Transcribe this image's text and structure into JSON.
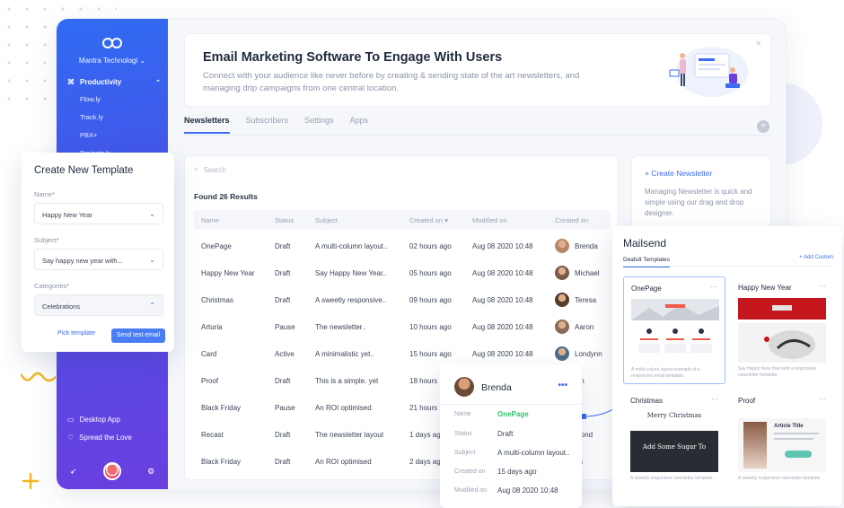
{
  "sidebar": {
    "org": "Mantra Technologi ⌄",
    "group": "Productivity",
    "items": [
      "Flow.ly",
      "Track.ly",
      "PBX+",
      "Projects.ly"
    ],
    "bottom": [
      "Desktop App",
      "Spread the Love"
    ]
  },
  "hero": {
    "title": "Email Marketing Software To Engage With Users",
    "subtitle": "Connect with your audience like never before by creating & sending state of the art newsletters, and managing drip campaigns from one central location."
  },
  "tabs": [
    "Newsletters",
    "Subscribers",
    "Settings",
    "Apps"
  ],
  "table": {
    "search_placeholder": "Search",
    "found": "Found 26 Results",
    "headers": [
      "Name",
      "Status",
      "Subject",
      "Created on",
      "Modified on",
      "Created on"
    ],
    "rows": [
      {
        "name": "OnePage",
        "status": "Draft",
        "subject": "A multi-column layout..",
        "created": "02 hours ago",
        "modified": "Aug 08 2020 10:48",
        "by": "Brenda"
      },
      {
        "name": "Happy New Year",
        "status": "Draft",
        "subject": "Say Happy New Year..",
        "created": "05 hours ago",
        "modified": "Aug 08 2020 10:48",
        "by": "Michael"
      },
      {
        "name": "Christmas",
        "status": "Draft",
        "subject": "A sweetly responsive..",
        "created": "09 hours ago",
        "modified": "Aug 08 2020 10:48",
        "by": "Teresa"
      },
      {
        "name": "Arturia",
        "status": "Pause",
        "subject": "The newsletter..",
        "created": "10 hours ago",
        "modified": "Aug 08 2020 10:48",
        "by": "Aaron"
      },
      {
        "name": "Card",
        "status": "Active",
        "subject": "A minimalistic yet..",
        "created": "15 hours ago",
        "modified": "Aug 08 2020 10:48",
        "by": "Londynn"
      },
      {
        "name": "Proof",
        "status": "Draft",
        "subject": "This is a simple. yet",
        "created": "18 hours",
        "modified": "",
        "by": "lan"
      },
      {
        "name": "Black Friday",
        "status": "Pause",
        "subject": "An ROI optimised",
        "created": "21 hours",
        "modified": "",
        "by": "ys"
      },
      {
        "name": "Recast",
        "status": "Draft",
        "subject": "The newsletter layout",
        "created": "1 days ag",
        "modified": "",
        "by": "mond"
      },
      {
        "name": "Black Friday",
        "status": "Draft",
        "subject": "An ROI optimised",
        "created": "2 days ag",
        "modified": "",
        "by": "an"
      }
    ]
  },
  "newsletter_card": {
    "title": "+ Create Newsletter",
    "desc": "Managing Newsletter is quick and simple using our drag and drop designer."
  },
  "create_template": {
    "title": "Create New Template",
    "name_label": "Name*",
    "name_value": "Happy New Year",
    "subject_label": "Subject*",
    "subject_value": "Say happy new year with...",
    "categories_label": "Categories*",
    "categories_value": "Celebrations",
    "pick_label": "Pick template",
    "send_label": "Send test email"
  },
  "popup": {
    "name": "Brenda",
    "more": "•••",
    "labels": [
      "Name",
      "Status",
      "Subject",
      "Created on",
      "Modified on"
    ],
    "values": [
      "OnePage",
      "Draft",
      "A multi-column layout..",
      "15 days ago",
      "Aug 08 2020 10:48"
    ]
  },
  "mailsend": {
    "title": "Mailsend",
    "tab": "Deafult Templates",
    "add": "+ Add Custom",
    "templates": [
      {
        "name": "OnePage",
        "desc": "A multi-colunn layout example of a responsive email template."
      },
      {
        "name": "Happy New Year",
        "desc": "Say Happy New Year with a responsive newsletter template."
      },
      {
        "name": "Christmas",
        "desc": "A sweetly responsive newsletter template."
      },
      {
        "name": "Proof",
        "desc": "A sweetly responsive newsletter template."
      }
    ],
    "art_text": [
      "Merry Christmas",
      "Add Some Sugar To",
      "Article Title"
    ]
  },
  "colors": {
    "accent": "#3b6cf3",
    "green": "#2fc46b",
    "sidebar_start": "#2f6bf2",
    "sidebar_end": "#6a3fe0"
  }
}
